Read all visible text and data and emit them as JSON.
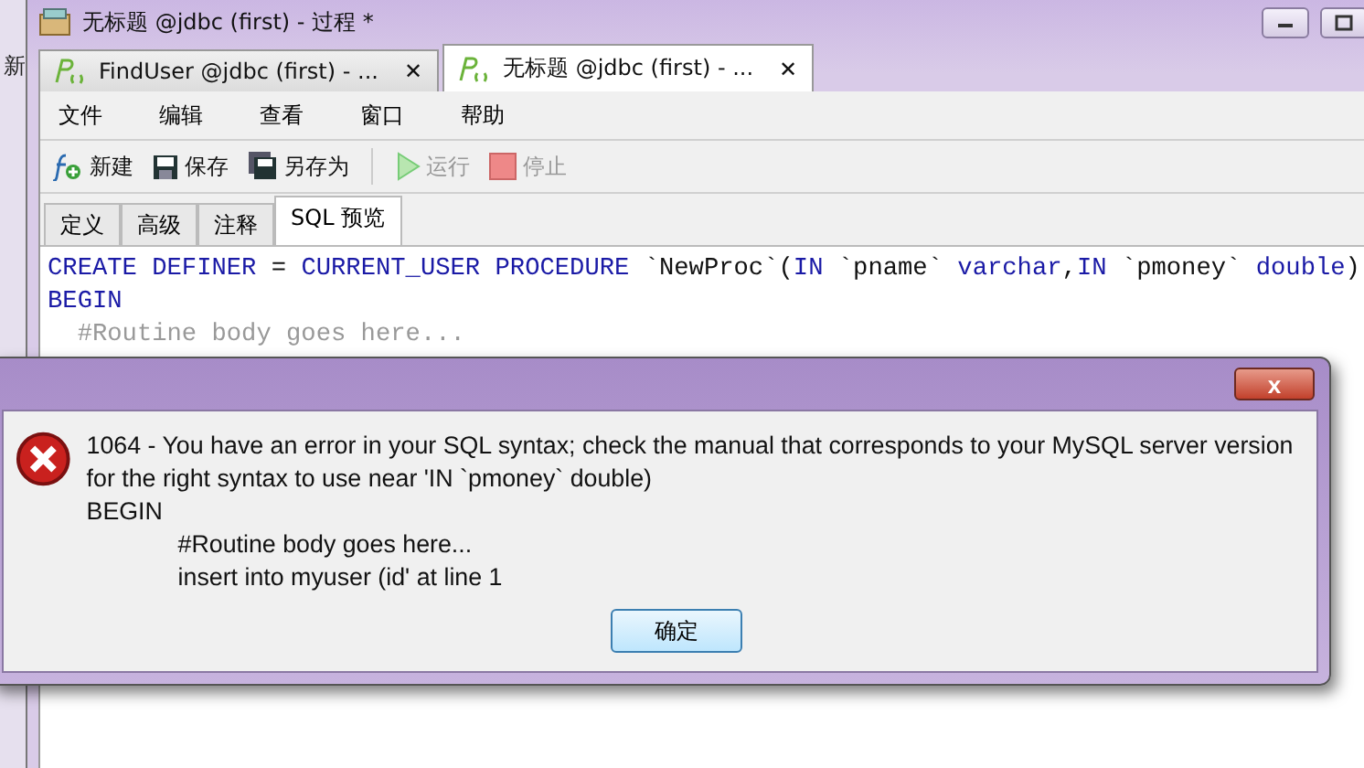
{
  "left_strip": {
    "label": "新"
  },
  "window": {
    "title": "无标题 @jdbc (first) - 过程 *"
  },
  "tabs": [
    {
      "label": "FindUser @jdbc (first) - ...",
      "close": "✕",
      "selected": false
    },
    {
      "label": "无标题 @jdbc (first) - ...",
      "close": "✕",
      "selected": true
    }
  ],
  "menu": [
    "文件",
    "编辑",
    "查看",
    "窗口",
    "帮助"
  ],
  "toolbar": [
    {
      "kind": "new",
      "label": "新建",
      "disabled": false
    },
    {
      "kind": "save",
      "label": "保存",
      "disabled": false
    },
    {
      "kind": "saveas",
      "label": "另存为",
      "disabled": false
    },
    {
      "kind": "separator"
    },
    {
      "kind": "run",
      "label": "运行",
      "disabled": true
    },
    {
      "kind": "stop",
      "label": "停止",
      "disabled": true
    }
  ],
  "sub_tabs": [
    {
      "label": "定义",
      "selected": false
    },
    {
      "label": "高级",
      "selected": false
    },
    {
      "label": "注释",
      "selected": false
    },
    {
      "label": "SQL 预览",
      "selected": true
    }
  ],
  "code_lines": [
    [
      {
        "kind": "keyword",
        "text": "CREATE DEFINER"
      },
      {
        "kind": "plain",
        "text": " = "
      },
      {
        "kind": "keyword",
        "text": "CURRENT_USER PROCEDURE"
      },
      {
        "kind": "plain",
        "text": " `NewProc`("
      },
      {
        "kind": "keyword",
        "text": "IN"
      },
      {
        "kind": "plain",
        "text": " `pname` "
      },
      {
        "kind": "keyword",
        "text": "varchar"
      },
      {
        "kind": "plain",
        "text": ","
      },
      {
        "kind": "keyword",
        "text": "IN"
      },
      {
        "kind": "plain",
        "text": " `pmoney` "
      },
      {
        "kind": "keyword",
        "text": "double"
      },
      {
        "kind": "plain",
        "text": ")"
      }
    ],
    [
      {
        "kind": "keyword",
        "text": "BEGIN"
      }
    ],
    [
      {
        "kind": "comment",
        "text": "  #Routine body goes here..."
      }
    ]
  ],
  "dialog": {
    "close": "x",
    "message": [
      {
        "text": "1064 - You have an error in your SQL syntax; check the manual that corresponds to your MySQL server version for the right syntax to use near 'IN `pmoney` double)",
        "indented": false
      },
      {
        "text": "BEGIN",
        "indented": false
      },
      {
        "text": "#Routine body goes here...",
        "indented": true
      },
      {
        "text": "insert into myuser (id' at line 1",
        "indented": true
      }
    ],
    "button": "确定"
  }
}
